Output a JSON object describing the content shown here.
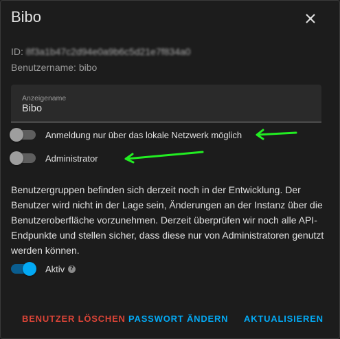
{
  "dialog": {
    "title": "Bibo",
    "id_prefix": "ID: ",
    "id_value": "8f3a1b47c2d94e0a9b6c5d21e7f834a0",
    "username_line": "Benutzername: bibo"
  },
  "display_name_field": {
    "label": "Anzeigename",
    "value": "Bibo"
  },
  "toggles": {
    "local_only": {
      "label": "Anmeldung nur über das lokale Netzwerk möglich",
      "checked": false
    },
    "admin": {
      "label": "Administrator",
      "checked": false
    },
    "active": {
      "label": "Aktiv",
      "checked": true
    }
  },
  "notice": "Benutzergruppen befinden sich derzeit noch in der Entwicklung. Der Benutzer wird nicht in der Lage sein, Änderungen an der Instanz über die Benutzeroberfläche vorzunehmen. Derzeit überprüfen wir noch alle API-Endpunkte und stellen sicher, dass diese nur von Administratoren genutzt werden können.",
  "buttons": {
    "delete": "BENUTZER LÖSCHEN",
    "change_password": "PASSWORT ÄNDERN",
    "update": "AKTUALISIEREN"
  },
  "icons": {
    "close": "close-icon",
    "help": "help-icon",
    "annotation_arrow": "arrow-icon"
  },
  "colors": {
    "background": "#1c1c1c",
    "accent": "#03a9f4",
    "danger": "#db4437",
    "annotation": "#22ee22"
  }
}
